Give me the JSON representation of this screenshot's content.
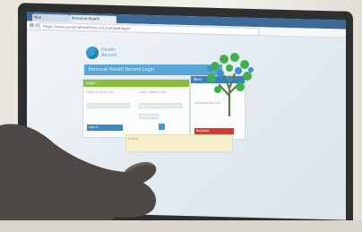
{
  "browser": {
    "tabs": [
      {
        "label": "Mail"
      },
      {
        "label": "Personal Health"
      }
    ],
    "address": "https://www.personalhealthrecord.example/login"
  },
  "page": {
    "brand_line1": "Health",
    "brand_line2": "Record",
    "banner_title": "Personal Health Record Login",
    "login_card": {
      "header": "Login",
      "column1_text": "Patient login text",
      "column2_text": "Login details text",
      "submit_label": "Log in"
    },
    "side_card": {
      "header": "New",
      "text": "Registration info",
      "button_label": "Register"
    },
    "note_text": "Notice"
  },
  "colors": {
    "banner": "#58a7d6",
    "login_header": "#8bbd3a",
    "side_header": "#3b7fc0",
    "register_button": "#d23a35",
    "tree_leaves": "#3fb04a",
    "tree_bubbles": "#3c8fd0"
  }
}
